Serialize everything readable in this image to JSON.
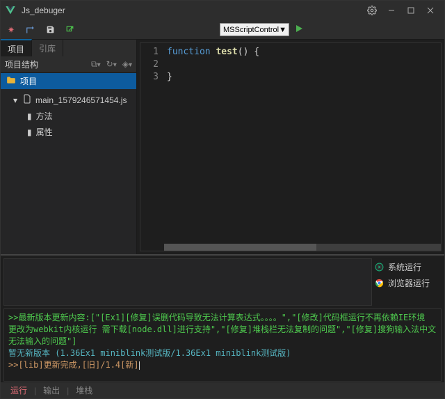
{
  "title": "Js_debuger",
  "toolbar": {
    "engine": "MSScriptControl"
  },
  "sidebar": {
    "tabs": [
      "项目",
      "引库"
    ],
    "header": "项目结构",
    "root": "项目",
    "file": "main_1579246571454.js",
    "nodes": [
      "方法",
      "属性"
    ]
  },
  "code": {
    "lines": [
      "1",
      "2",
      "3"
    ],
    "l1": {
      "kw": "function",
      "fn": "test",
      "rest": "() {"
    },
    "l3": "}"
  },
  "mid": {
    "sysrun": "系统运行",
    "browserrun": "浏览器运行"
  },
  "console": {
    "l1a": ">>最新版本更新内容:[\"[Ex1][修复]误删代码导致无法计算表达式。。。。\",\"[修改]代码框运行不再依赖IE环境 更改为webkit内核运行 需下载[node.dll]进行支持\",\"[修复]堆栈栏无法复制的问题\",\"[修复]搜狗输入法中文无法输入的问题\"]",
    "l2": "暂无新版本 (1.36Ex1 miniblink测试版/1.36Ex1 miniblink测试版)",
    "l3": ">>[lib]更新完成,[旧]/1.4[新]"
  },
  "bottom": {
    "tabs": [
      "运行",
      "输出",
      "堆栈"
    ]
  }
}
